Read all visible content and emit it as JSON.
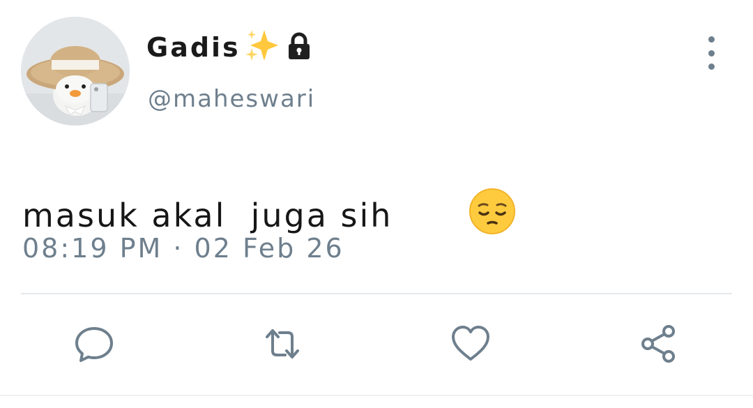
{
  "user": {
    "display_name": "Gadis",
    "name_emoji": "sparkles-icon",
    "protected_icon": "lock-icon",
    "handle": "@maheswari",
    "avatar": "profile-avatar-duck-with-straw-hat"
  },
  "tweet": {
    "text": "masuk akal  juga sih",
    "trailing_emoji": "pensive-face-icon",
    "timestamp": "08:19 PM · 02 Feb 26"
  },
  "actions": [
    {
      "name": "reply",
      "icon": "comment-icon"
    },
    {
      "name": "retweet",
      "icon": "retweet-icon"
    },
    {
      "name": "like",
      "icon": "heart-icon"
    },
    {
      "name": "share",
      "icon": "share-icon"
    }
  ],
  "colors": {
    "primary_text": "#161616",
    "secondary_text": "#6e7f8d",
    "divider": "#e6e9ec",
    "background": "#ffffff"
  }
}
